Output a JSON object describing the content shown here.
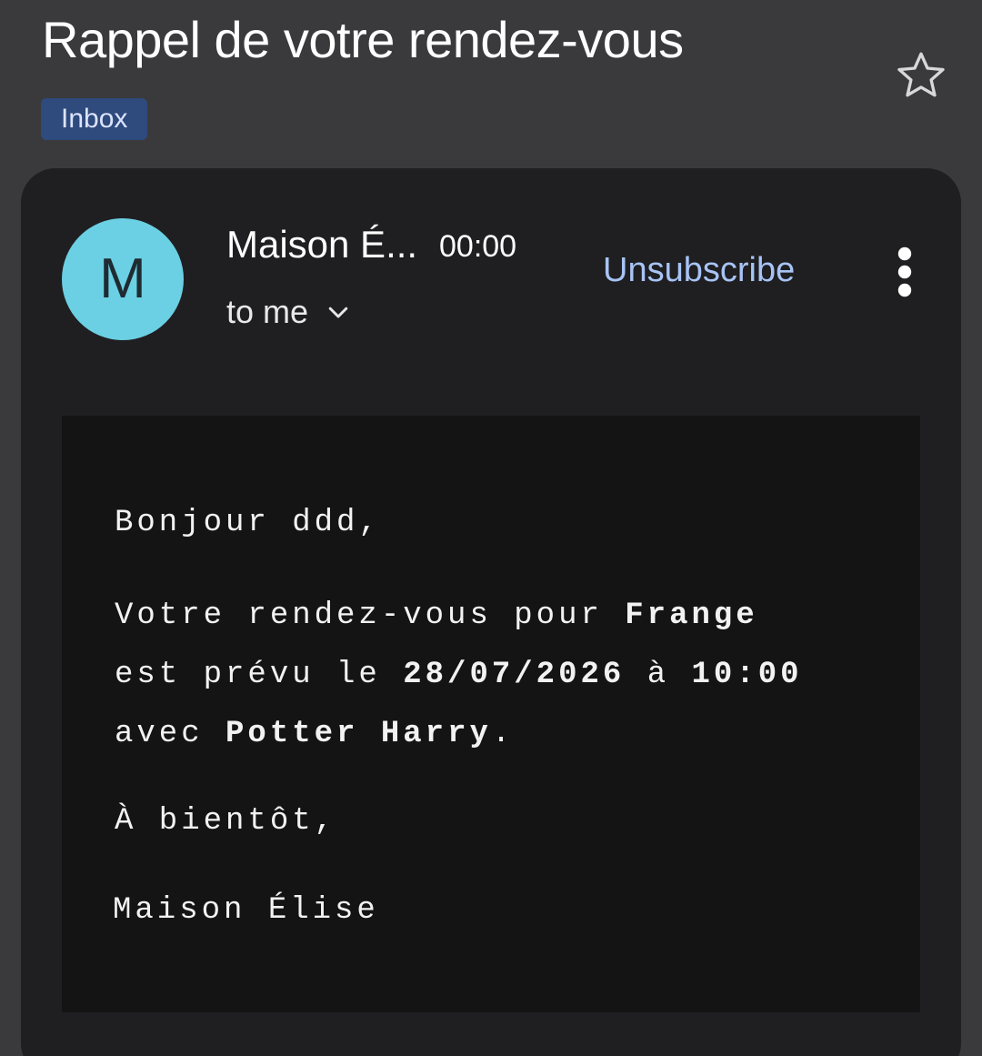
{
  "email": {
    "subject": "Rappel de votre rendez-vous",
    "label": "Inbox",
    "sender_initial": "M",
    "sender_name": "Maison É...",
    "time": "00:00",
    "recipient": "to me",
    "unsubscribe_label": "Unsubscribe"
  },
  "body": {
    "greeting": "Bonjour ddd,",
    "line1_prefix": "Votre rendez-vous pour ",
    "service": "Frange",
    "line2_prefix": "est prévu le ",
    "date": "28/07/2026",
    "at_word": " à ",
    "hour": "10:00",
    "line3_prefix": "avec ",
    "person": "Potter Harry",
    "line3_suffix": ".",
    "closing": "À bientôt,",
    "signature": "Maison Élise"
  },
  "icons": {
    "star": "star-outline-icon",
    "chevron": "chevron-down-icon",
    "more": "more-vertical-icon"
  },
  "colors": {
    "background": "#3a3a3d",
    "card": "#1f1f21",
    "body_block": "#141415",
    "label_chip": "#2f4a7c",
    "avatar": "#6bd0e3",
    "link": "#a8c3f5"
  }
}
